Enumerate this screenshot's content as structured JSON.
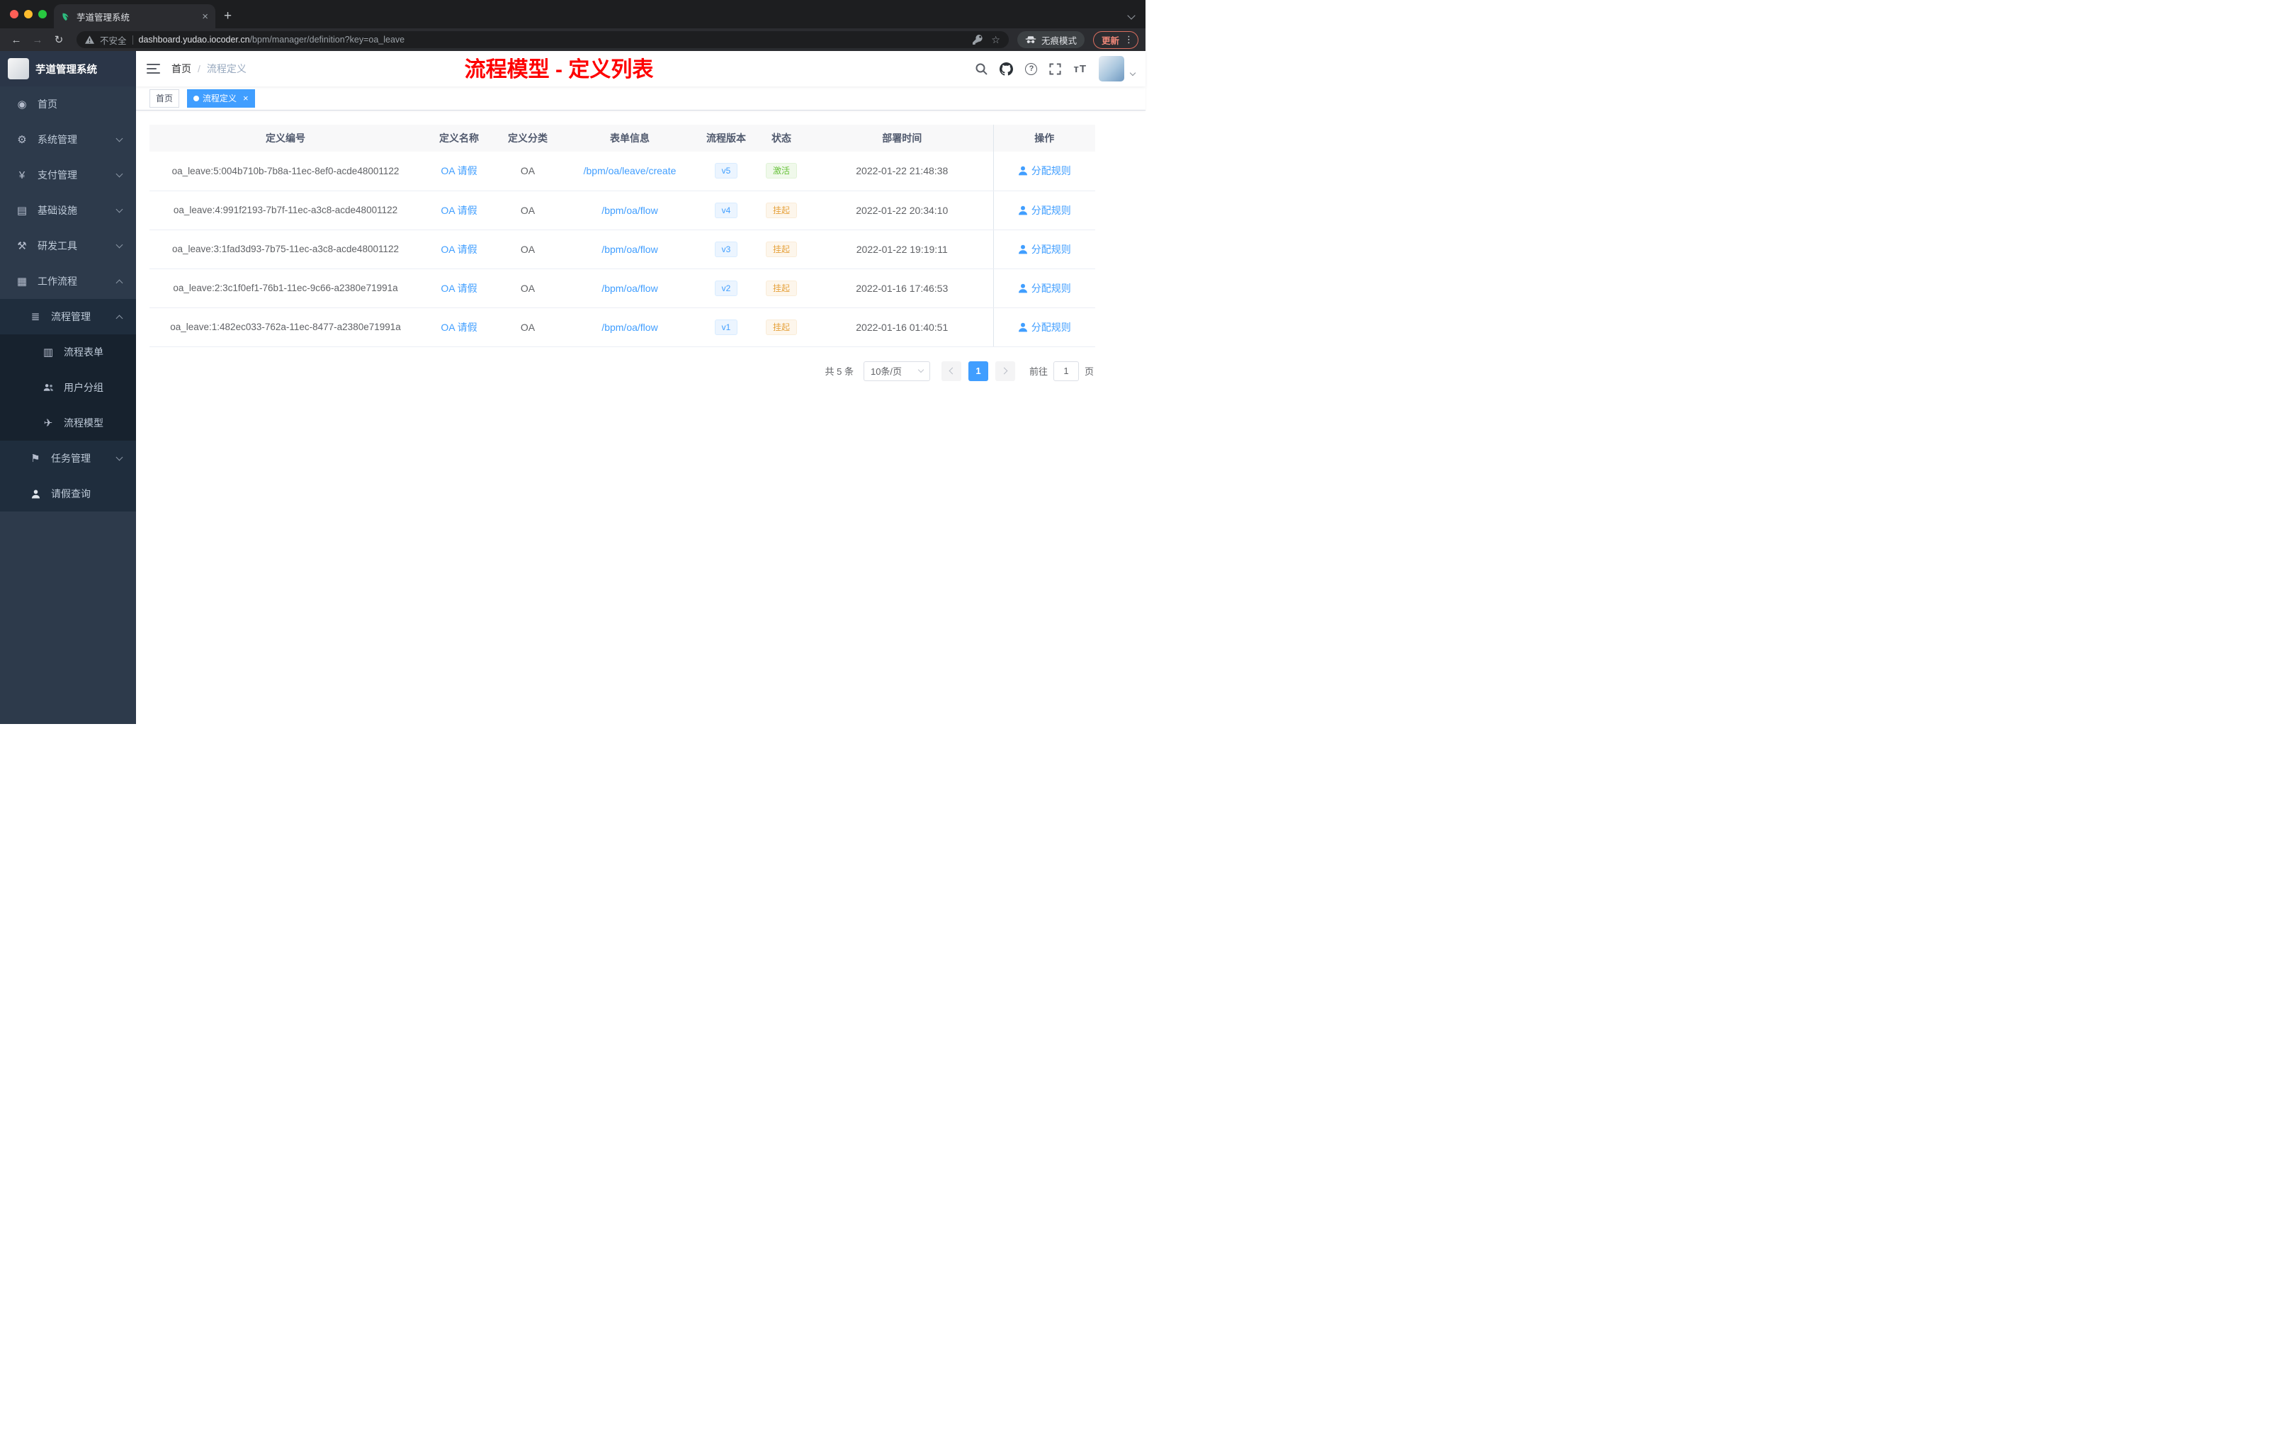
{
  "colors": {
    "accent": "#409eff",
    "success": "#67c23a",
    "warning": "#e6a23c",
    "annotation_red": "#ff0000",
    "sidebar_bg": "#2d3a4b"
  },
  "browser": {
    "tab_title": "芋道管理系统",
    "security_label": "不安全",
    "url_host": "dashboard.yudao.iocoder.cn",
    "url_path": "/bpm/manager/definition?key=oa_leave",
    "incognito_label": "无痕模式",
    "update_label": "更新"
  },
  "sidebar": {
    "app_title": "芋道管理系统",
    "menu": [
      {
        "label": "首页"
      },
      {
        "label": "系统管理"
      },
      {
        "label": "支付管理"
      },
      {
        "label": "基础设施"
      },
      {
        "label": "研发工具"
      },
      {
        "label": "工作流程"
      },
      {
        "label": "流程管理"
      },
      {
        "label": "流程表单"
      },
      {
        "label": "用户分组"
      },
      {
        "label": "流程模型"
      },
      {
        "label": "任务管理"
      },
      {
        "label": "请假查询"
      }
    ]
  },
  "header": {
    "breadcrumb_home": "首页",
    "breadcrumb_current": "流程定义",
    "annotation": "流程模型 - 定义列表"
  },
  "tags": {
    "home": "首页",
    "active": "流程定义"
  },
  "table": {
    "columns": {
      "id": "定义编号",
      "name": "定义名称",
      "category": "定义分类",
      "form": "表单信息",
      "version": "流程版本",
      "status": "状态",
      "deploy_time": "部署时间",
      "action": "操作"
    },
    "rows": [
      {
        "id": "oa_leave:5:004b710b-7b8a-11ec-8ef0-acde48001122",
        "name": "OA 请假",
        "category": "OA",
        "form": "/bpm/oa/leave/create",
        "version": "v5",
        "status": "激活",
        "status_type": "success",
        "deploy_time": "2022-01-22 21:48:38",
        "action": "分配规则"
      },
      {
        "id": "oa_leave:4:991f2193-7b7f-11ec-a3c8-acde48001122",
        "name": "OA 请假",
        "category": "OA",
        "form": "/bpm/oa/flow",
        "version": "v4",
        "status": "挂起",
        "status_type": "warning",
        "deploy_time": "2022-01-22 20:34:10",
        "action": "分配规则"
      },
      {
        "id": "oa_leave:3:1fad3d93-7b75-11ec-a3c8-acde48001122",
        "name": "OA 请假",
        "category": "OA",
        "form": "/bpm/oa/flow",
        "version": "v3",
        "status": "挂起",
        "status_type": "warning",
        "deploy_time": "2022-01-22 19:19:11",
        "action": "分配规则"
      },
      {
        "id": "oa_leave:2:3c1f0ef1-76b1-11ec-9c66-a2380e71991a",
        "name": "OA 请假",
        "category": "OA",
        "form": "/bpm/oa/flow",
        "version": "v2",
        "status": "挂起",
        "status_type": "warning",
        "deploy_time": "2022-01-16 17:46:53",
        "action": "分配规则"
      },
      {
        "id": "oa_leave:1:482ec033-762a-11ec-8477-a2380e71991a",
        "name": "OA 请假",
        "category": "OA",
        "form": "/bpm/oa/flow",
        "version": "v1",
        "status": "挂起",
        "status_type": "warning",
        "deploy_time": "2022-01-16 01:40:51",
        "action": "分配规则"
      }
    ]
  },
  "pagination": {
    "total": "共 5 条",
    "page_size": "10条/页",
    "page": "1",
    "goto_label": "前往",
    "goto_value": "1",
    "unit_label": "页"
  }
}
